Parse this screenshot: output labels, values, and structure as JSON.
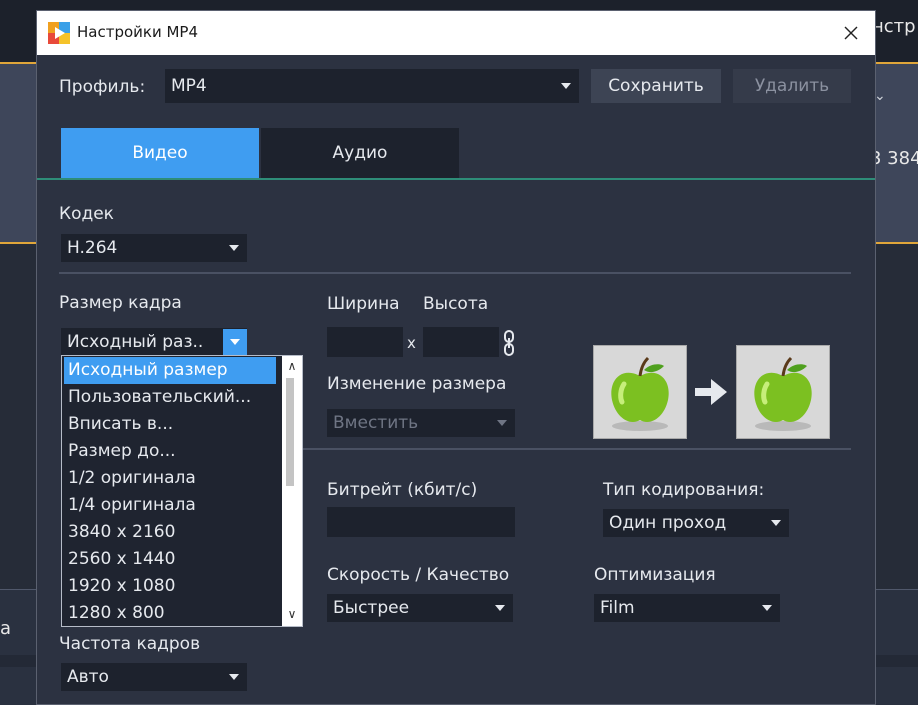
{
  "background": {
    "top_right_text": "нстр",
    "right_number": "3 384",
    "left_text": "а"
  },
  "dialog": {
    "title": "Настройки MP4",
    "close_label": "✕"
  },
  "profile": {
    "label": "Профиль:",
    "value": "MP4",
    "save_label": "Сохранить",
    "delete_label": "Удалить"
  },
  "tabs": [
    {
      "label": "Видео",
      "active": true
    },
    {
      "label": "Аудио",
      "active": false
    }
  ],
  "codec": {
    "label": "Кодек",
    "value": "H.264"
  },
  "frame_size": {
    "label": "Размер кадра",
    "value": "Исходный раз..",
    "options": [
      "Исходный размер",
      "Пользовательский...",
      "Вписать в...",
      "Размер до...",
      "1/2 оригинала",
      "1/4 оригинала",
      "3840 x 2160",
      "2560 x 1440",
      "1920 x 1080",
      "1280 x 800"
    ],
    "selected_index": 0
  },
  "dimensions": {
    "width_label": "Ширина",
    "height_label": "Высота",
    "width_value": "",
    "height_value": "",
    "separator": "x",
    "link_icon": "chain-link-icon"
  },
  "resize": {
    "label": "Изменение размера",
    "value": "Вместить"
  },
  "bitrate": {
    "label": "Битрейт (кбит/с)",
    "value": ""
  },
  "encoding_type": {
    "label": "Тип кодирования:",
    "value": "Один проход"
  },
  "speed_quality": {
    "label": "Скорость / Качество",
    "value": "Быстрее"
  },
  "optimization": {
    "label": "Оптимизация",
    "value": "Film"
  },
  "frame_rate": {
    "label": "Частота кадров",
    "value": "Авто"
  },
  "colors": {
    "accent": "#3f9df1",
    "tab_line": "#2e8d78",
    "highlight": "#e0a63a"
  }
}
